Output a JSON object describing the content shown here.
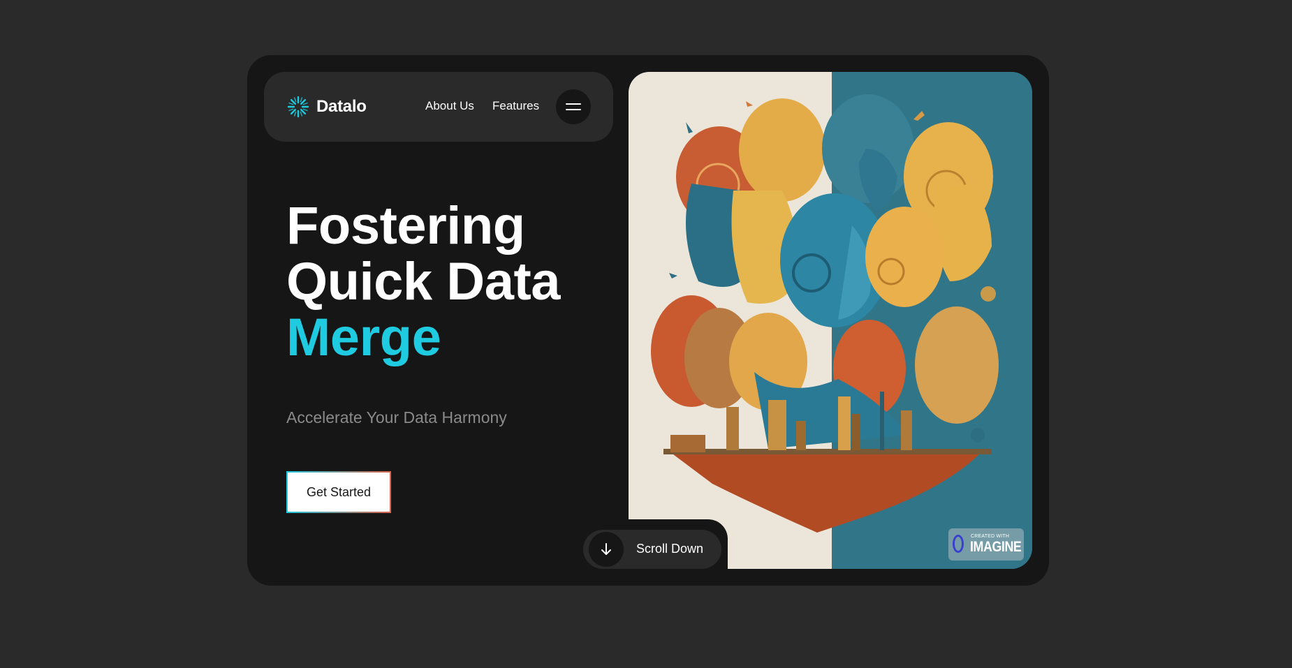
{
  "brand": {
    "name": "Datalo",
    "accent_color": "#1ecbe1",
    "logo_icon": "starburst-icon"
  },
  "nav": {
    "links": [
      {
        "label": "About Us"
      },
      {
        "label": "Features"
      }
    ],
    "menu_icon": "hamburger-icon"
  },
  "hero": {
    "headline_lines": [
      "Fostering",
      "Quick Data",
      "Merge"
    ],
    "subtitle": "Accelerate Your Data Harmony",
    "cta_label": "Get Started"
  },
  "scroll": {
    "label": "Scroll Down",
    "icon": "arrow-down-icon"
  },
  "artwork": {
    "description_icon": "faces-artwork",
    "badge_top": "CREATED WITH",
    "badge_bottom": "IMAGINE"
  }
}
